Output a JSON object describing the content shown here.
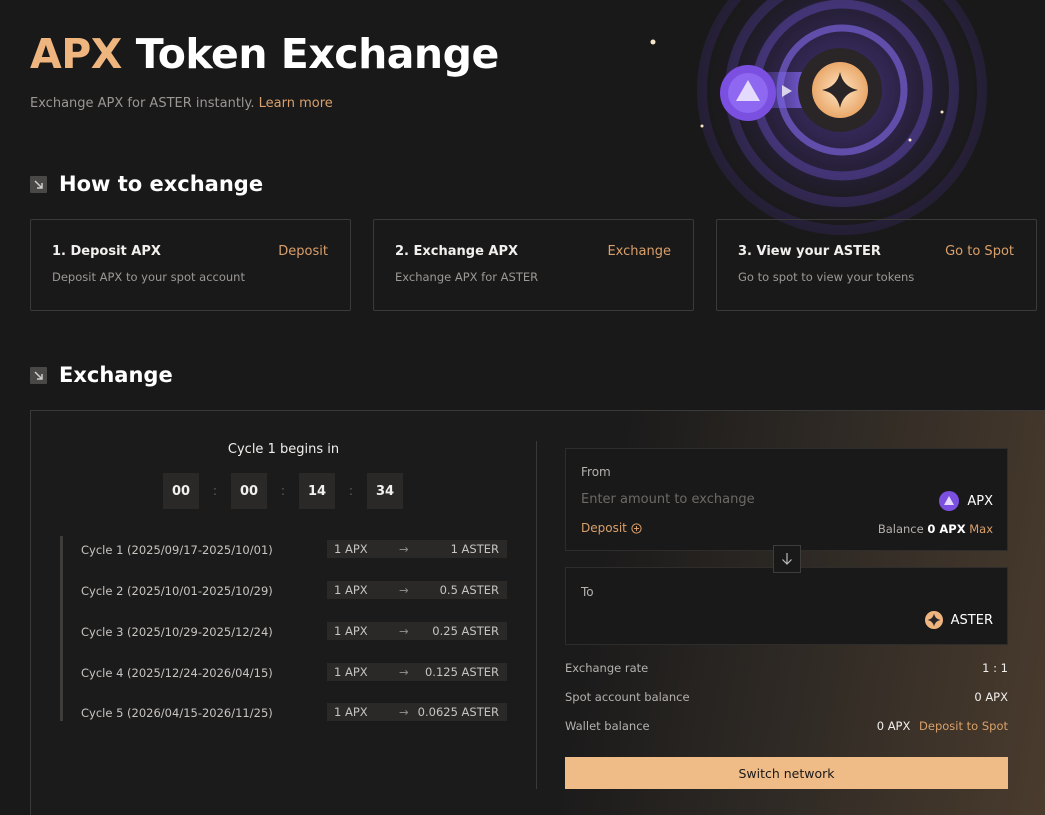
{
  "hero": {
    "title_accent": "APX",
    "title_rest": "Token Exchange",
    "subtitle": "Exchange APX for ASTER instantly.",
    "learn_more": "Learn more"
  },
  "how_to": {
    "title": "How to exchange",
    "steps": [
      {
        "title": "1. Deposit APX",
        "desc": "Deposit APX to your spot account",
        "action": "Deposit"
      },
      {
        "title": "2. Exchange APX",
        "desc": "Exchange APX for ASTER",
        "action": "Exchange"
      },
      {
        "title": "3. View your ASTER",
        "desc": "Go to spot to view your tokens",
        "action": "Go to Spot"
      }
    ]
  },
  "exchange": {
    "title": "Exchange",
    "cycle_title": "Cycle 1 begins in",
    "countdown": [
      "00",
      "00",
      "14",
      "34"
    ],
    "countdown_sep": ":",
    "cycles": [
      {
        "name": "Cycle 1 (2025/09/17-2025/10/01)",
        "from": "1 APX",
        "to": "1 ASTER"
      },
      {
        "name": "Cycle 2 (2025/10/01-2025/10/29)",
        "from": "1 APX",
        "to": "0.5 ASTER"
      },
      {
        "name": "Cycle 3 (2025/10/29-2025/12/24)",
        "from": "1 APX",
        "to": "0.25 ASTER"
      },
      {
        "name": "Cycle 4 (2025/12/24-2026/04/15)",
        "from": "1 APX",
        "to": "0.125 ASTER"
      },
      {
        "name": "Cycle 5 (2026/04/15-2026/11/25)",
        "from": "1 APX",
        "to": "0.0625 ASTER"
      }
    ],
    "rate_arrow": "→",
    "from_box": {
      "label": "From",
      "placeholder": "Enter amount to exchange",
      "token": "APX",
      "deposit": "Deposit",
      "balance_label": "Balance",
      "balance_value": "0 APX",
      "max": "Max"
    },
    "to_box": {
      "label": "To",
      "token": "ASTER"
    },
    "info": {
      "rate_label": "Exchange rate",
      "rate_value": "1 : 1",
      "spot_label": "Spot account balance",
      "spot_value": "0 APX",
      "wallet_label": "Wallet balance",
      "wallet_value": "0 APX",
      "wallet_link": "Deposit to Spot"
    },
    "switch_button": "Switch network"
  },
  "colors": {
    "accent": "#efb57f",
    "link": "#d9a06b",
    "button": "#efbb86",
    "bg": "#1a1919",
    "apx_purple": "#7b4fe0"
  }
}
